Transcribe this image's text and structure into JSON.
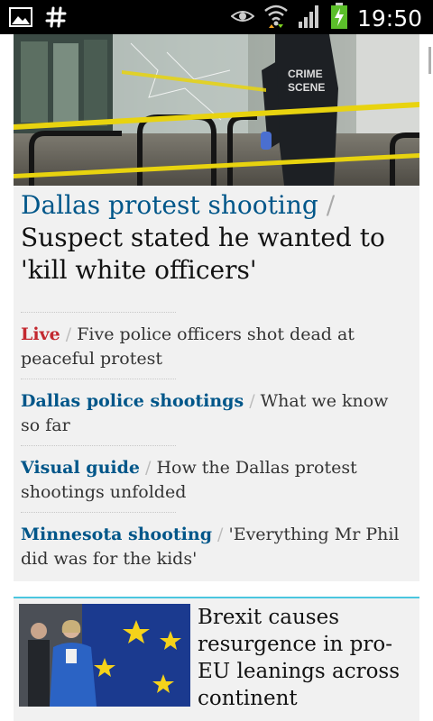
{
  "status_bar": {
    "time": "19:50",
    "icons": [
      "gallery-icon",
      "hashtag-icon",
      "eye-icon",
      "wifi-icon",
      "signal-icon",
      "battery-icon"
    ]
  },
  "main_story": {
    "kicker": "Dallas protest shooting",
    "separator": " / ",
    "title": "Suspect stated he wanted to 'kill white officers'"
  },
  "sublinks": [
    {
      "kicker": "Live",
      "separator": " / ",
      "text": "Five police officers shot dead at peaceful protest",
      "live": true
    },
    {
      "kicker": "Dallas police shootings",
      "separator": " / ",
      "text": "What we know so far",
      "live": false
    },
    {
      "kicker": "Visual guide",
      "separator": " / ",
      "text": "How the Dallas protest shootings unfolded",
      "live": false
    },
    {
      "kicker": "Minnesota shooting",
      "separator": " / ",
      "text": "'Everything Mr Phil did was for the kids'",
      "live": false
    }
  ],
  "hero_image": {
    "label_line1": "CRIME",
    "label_line2": "SCENE"
  },
  "second_story": {
    "title": "Brexit causes resurgence in pro-EU leanings across continent"
  },
  "colors": {
    "kicker": "#005689",
    "live": "#c3282f",
    "card_bg": "#f1f1f1",
    "accent_border": "#4bc6df"
  }
}
